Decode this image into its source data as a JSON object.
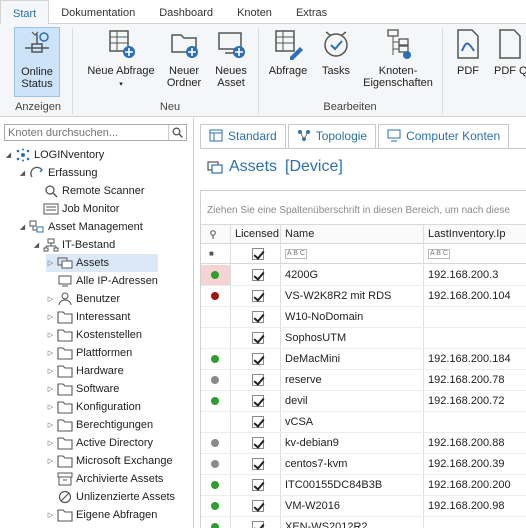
{
  "ribbon": {
    "tabs": [
      "Start",
      "Dokumentation",
      "Dashboard",
      "Knoten",
      "Extras"
    ],
    "active_tab": "Start",
    "buttons": {
      "online_status": "Online\nStatus",
      "neue_abfrage": "Neue Abfrage",
      "neuer_ordner": "Neuer\nOrdner",
      "neues_asset": "Neues\nAsset",
      "abfrage": "Abfrage",
      "tasks": "Tasks",
      "knoten_eigenschaften": "Knoten-\nEigenschaften",
      "pdf": "PDF",
      "pdf_q": "PDF Q"
    },
    "groups": {
      "anzeigen": "Anzeigen",
      "neu": "Neu",
      "bearbeiten": "Bearbeiten"
    }
  },
  "left": {
    "search_placeholder": "Knoten durchsuchen...",
    "tree": [
      {
        "label": "LOGINventory",
        "indent": 0,
        "toggle": "open",
        "icon": "logo-icon"
      },
      {
        "label": "Erfassung",
        "indent": 1,
        "toggle": "open",
        "icon": "erfassung-icon"
      },
      {
        "label": "Remote Scanner",
        "indent": 2,
        "toggle": "",
        "icon": "scanner-icon"
      },
      {
        "label": "Job Monitor",
        "indent": 2,
        "toggle": "",
        "icon": "monitor-icon"
      },
      {
        "label": "Asset Management",
        "indent": 1,
        "toggle": "open",
        "icon": "asset-management-icon"
      },
      {
        "label": "IT-Bestand",
        "indent": 2,
        "toggle": "open",
        "icon": "bestand-icon"
      },
      {
        "label": "Assets",
        "indent": 3,
        "toggle": "closed",
        "icon": "assets-icon",
        "selected": true
      },
      {
        "label": "Alle IP-Adressen",
        "indent": 3,
        "toggle": "",
        "icon": "ip-icon"
      },
      {
        "label": "Benutzer",
        "indent": 3,
        "toggle": "closed",
        "icon": "user-icon"
      },
      {
        "label": "Interessant",
        "indent": 3,
        "toggle": "closed",
        "icon": "folder-icon"
      },
      {
        "label": "Kostenstellen",
        "indent": 3,
        "toggle": "closed",
        "icon": "folder-icon"
      },
      {
        "label": "Plattformen",
        "indent": 3,
        "toggle": "closed",
        "icon": "folder-icon"
      },
      {
        "label": "Hardware",
        "indent": 3,
        "toggle": "closed",
        "icon": "folder-icon"
      },
      {
        "label": "Software",
        "indent": 3,
        "toggle": "closed",
        "icon": "folder-icon"
      },
      {
        "label": "Konfiguration",
        "indent": 3,
        "toggle": "closed",
        "icon": "folder-icon"
      },
      {
        "label": "Berechtigungen",
        "indent": 3,
        "toggle": "closed",
        "icon": "folder-icon"
      },
      {
        "label": "Active Directory",
        "indent": 3,
        "toggle": "closed",
        "icon": "folder-icon"
      },
      {
        "label": "Microsoft Exchange",
        "indent": 3,
        "toggle": "closed",
        "icon": "folder-icon"
      },
      {
        "label": "Archivierte Assets",
        "indent": 3,
        "toggle": "",
        "icon": "archive-icon"
      },
      {
        "label": "Unlizenzierte Assets",
        "indent": 3,
        "toggle": "",
        "icon": "unlicensed-icon"
      },
      {
        "label": "Eigene Abfragen",
        "indent": 3,
        "toggle": "closed",
        "icon": "folder-icon"
      }
    ]
  },
  "right": {
    "tabs": [
      "Standard",
      "Topologie",
      "Computer Konten"
    ],
    "active_tab": "Standard",
    "title": "Assets",
    "title_type": "[Device]",
    "group_hint": "Ziehen Sie eine Spaltenüberschrift in diesen Bereich, um nach diese",
    "columns": [
      "Licensed",
      "Name",
      "LastInventory.Ip"
    ],
    "status_colors": {
      "green": "#2e9e2e",
      "red": "#a31515",
      "gray": "#8a8a8a"
    },
    "rows": [
      {
        "status": "green",
        "highlight": true,
        "licensed": true,
        "name": "4200G",
        "ip": "192.168.200.3"
      },
      {
        "status": "red",
        "licensed": true,
        "name": "VS-W2K8R2 mit RDS",
        "ip": "192.168.200.104"
      },
      {
        "status": "",
        "licensed": true,
        "name": "W10-NoDomain",
        "ip": ""
      },
      {
        "status": "",
        "licensed": true,
        "name": "SophosUTM",
        "ip": ""
      },
      {
        "status": "green",
        "licensed": true,
        "name": "DeMacMini",
        "ip": "192.168.200.184"
      },
      {
        "status": "gray",
        "licensed": true,
        "name": "reserve",
        "ip": "192.168.200.78"
      },
      {
        "status": "green",
        "licensed": true,
        "name": "devil",
        "ip": "192.168.200.72"
      },
      {
        "status": "",
        "licensed": true,
        "name": "vCSA",
        "ip": ""
      },
      {
        "status": "gray",
        "licensed": true,
        "name": "kv-debian9",
        "ip": "192.168.200.88"
      },
      {
        "status": "gray",
        "licensed": true,
        "name": "centos7-kvm",
        "ip": "192.168.200.39"
      },
      {
        "status": "green",
        "licensed": true,
        "name": "ITC00155DC84B3B",
        "ip": "192.168.200.200"
      },
      {
        "status": "green",
        "licensed": true,
        "name": "VM-W2016",
        "ip": "192.168.200.98"
      },
      {
        "status": "green",
        "licensed": true,
        "name": "XEN-WS2012R2",
        "ip": ""
      }
    ]
  }
}
